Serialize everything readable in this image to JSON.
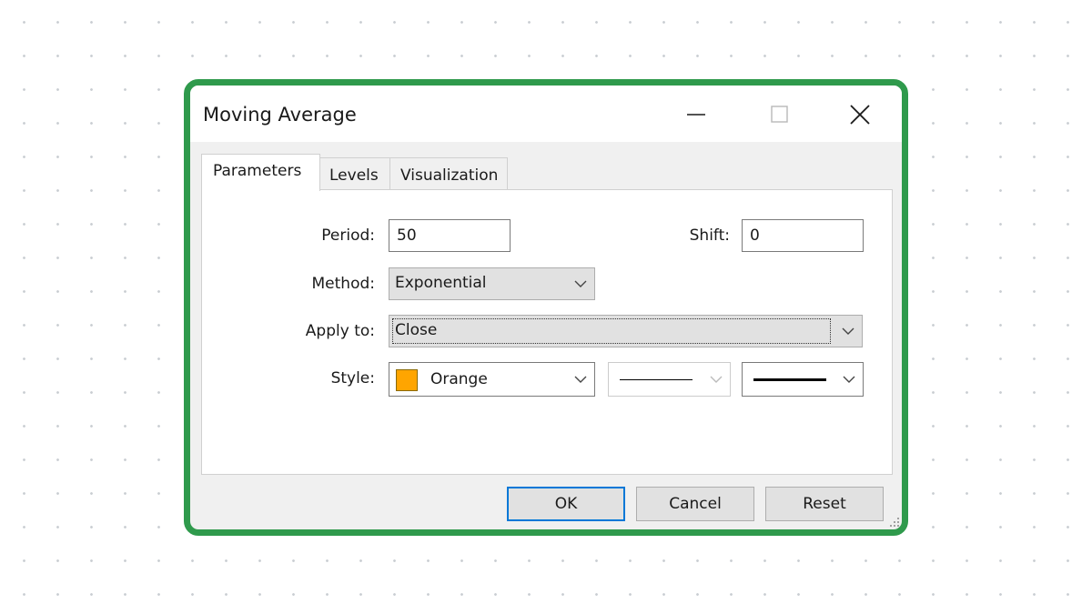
{
  "window": {
    "title": "Moving Average",
    "controls": [
      "minimize-icon",
      "maximize-icon",
      "close-icon"
    ]
  },
  "tabs": [
    {
      "label": "Parameters",
      "active": true
    },
    {
      "label": "Levels",
      "active": false
    },
    {
      "label": "Visualization",
      "active": false
    }
  ],
  "form": {
    "period_label": "Period:",
    "period_value": "50",
    "shift_label": "Shift:",
    "shift_value": "0",
    "method_label": "Method:",
    "method_value": "Exponential",
    "apply_label": "Apply to:",
    "apply_value": "Close",
    "style_label": "Style:",
    "style_color_name": "Orange",
    "style_color_hex": "#ffa500",
    "style_line_type": "solid",
    "style_line_width": "thick"
  },
  "buttons": {
    "ok": "OK",
    "cancel": "Cancel",
    "reset": "Reset"
  },
  "colors": {
    "frame_highlight": "#2f9a4c",
    "default_button_border": "#0078d7"
  }
}
